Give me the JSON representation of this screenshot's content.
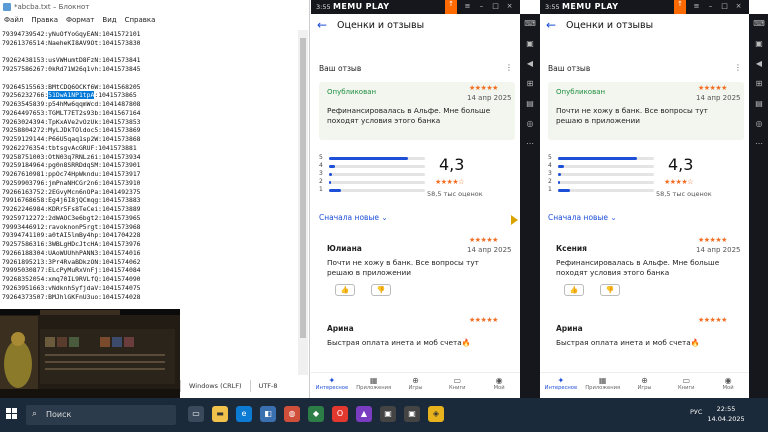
{
  "notepad": {
    "title": "*abcba.txt – Блокнот",
    "menu": [
      "Файл",
      "Правка",
      "Формат",
      "Вид",
      "Справка"
    ],
    "lines": [
      "79394739542:yNuOfYoGqyEAN:1041572101",
      "79261376514:NaeheKI8AV9Ot:1041573830",
      "",
      "79262438153:usVWHumtD8FzN:1041573841",
      "79257586267:0kRd71W26q1vh:1041573845",
      "",
      "79264515563:BMtCDQ6OCKf6W:1041568205",
      "79256232766:",
      "79263545839:p54hMw6qqmWcd:1041487808",
      "79264497653:TGMLT7ET2s93b:1041567164",
      "79263024394:TpKxAVe2vOzUk:1041573853",
      "79258804272:MyLJDkTOldoc5:1041573869",
      "79259129144:P66U5qaq1sp2W:1041573868",
      "79262276354:tbtsgvAcGRUF:1041573881",
      "79258751003:OtN03q7RNLz6i:1041573934",
      "79259184964:pg0n8SRRDdqSM:1041573901",
      "79267610981:ppOc74HpWkndu:1041573917",
      "79259903796:jmPnaNHCGr2n6:1041573910",
      "79266163752:2EGvyMcn6nOPa:1041492375",
      "79916768658:Eg4j6I8jQCmqg:1041573883",
      "79262246984:KDRr5Fs8TeCei:1041573889",
      "79259712272:2dWAOC3e6bgt2:1041573965",
      "79993446912:ravoknonP5rgt:1041573968",
      "79394741109:a0tAI5lmBy4hp:1041704228",
      "79257586316:3WBLgHDcJtcHA:1041573976",
      "79266188304:UAoWUUhhPANN3:1041574016",
      "79261895213:3Pr4RvaBDkzON:1041574062",
      "79995030877:ELcPyMuRxVnFj:1041574084",
      "79268352054:xmq70IL9RVLfQ:1041574090",
      "79263951663:vNdknhSyfjdaV:1041574075",
      "79264373507:BMJhlGKFnU3uo:1041574028"
    ],
    "highlight": "51DwA1NP1tpA",
    "highlight_tail": ":1041573865",
    "status": [
      "Windows (CRLF)",
      "UTF-8"
    ]
  },
  "memu": {
    "brand": "MEMU PLAY",
    "time": "3:55",
    "screen": {
      "title": "Оценки и отзывы",
      "your_review": "Ваш отзыв",
      "published": "Опубликован",
      "avg": "4,3",
      "count": "58,5 тыс оценок",
      "more_link": "Сначала новые ⌄",
      "bar_labels": [
        "5",
        "4",
        "3",
        "2",
        "1"
      ],
      "bars": [
        0.82,
        0.06,
        0.03,
        0.02,
        0.12
      ],
      "second_author": "Арина",
      "second_text": "Быстрая оплата инета и моб счета🔥",
      "nav": [
        "Интересное",
        "Приложения",
        "Игры",
        "Книги",
        "Мой"
      ]
    },
    "left": {
      "date": "14 апр 2025",
      "my_text": "Рефинансировалась в Альфе. Мне больше походят условия этого банка",
      "author": "Юлиана",
      "author_date": "14 апр 2025",
      "author_text": "Почти не хожу в банк. Все вопросы тут решаю в приложении"
    },
    "right": {
      "date": "14 апр 2025",
      "my_text": "Почти не хожу в банк. Все вопросы тут решаю в приложении",
      "author": "Ксения",
      "author_date": "14 апр 2025",
      "author_text": "Рефинансировалась в Альфе. Мне больше походят условия этого банка"
    }
  },
  "stars": "★★★★★",
  "stars4": "★★★★☆",
  "taskbar": {
    "search": "Поиск",
    "lang": "РУС",
    "time": "22:55",
    "date": "14.04.2025"
  },
  "colors": {
    "accent": "#1d4fd8",
    "star": "#f36c21",
    "published": "#1e8e3e",
    "memu_orange": "#ff6a00"
  }
}
